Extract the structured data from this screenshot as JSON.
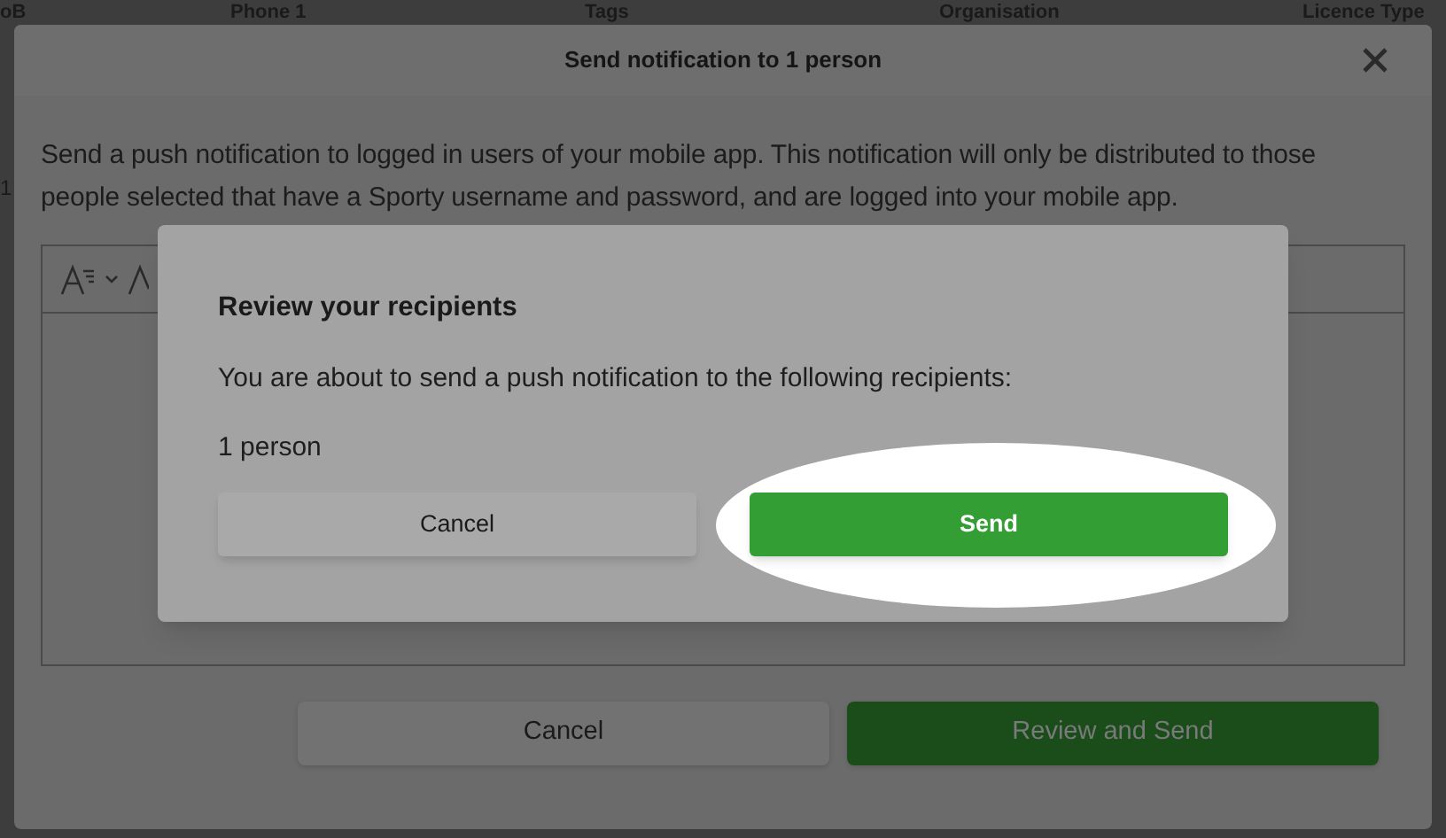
{
  "background_table": {
    "columns": [
      "oB",
      "Phone 1",
      "Tags",
      "Organisation",
      "Licence Type"
    ],
    "row_fragment": "1"
  },
  "modal": {
    "title": "Send notification to 1 person",
    "description": "Send a push notification to logged in users of your mobile app. This notification will only be distributed to those people selected that have a Sporty username and password, and are logged into your mobile app.",
    "buttons": [
      {
        "label": "Cancel",
        "kind": "secondary"
      },
      {
        "label": "Review and Send",
        "kind": "primary"
      }
    ]
  },
  "confirm_dialog": {
    "title": "Review your recipients",
    "message": "You are about to send a push notification to the following recipients:",
    "recipients": "1 person",
    "buttons": [
      {
        "label": "Cancel",
        "kind": "secondary",
        "highlighted": false
      },
      {
        "label": "Send",
        "kind": "primary",
        "highlighted": true
      }
    ]
  }
}
